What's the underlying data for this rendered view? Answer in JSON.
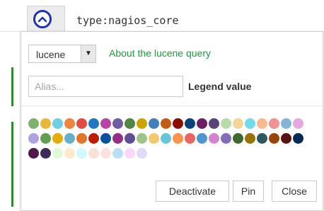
{
  "query": {
    "text": "type:nagios_core",
    "toggle_icon": "chevron-up-icon",
    "accent_color": "#1f33b0"
  },
  "popover": {
    "language_select": {
      "value": "lucene",
      "options": [
        "lucene"
      ]
    },
    "about_link": "About the lucene query",
    "alias_input": {
      "value": "",
      "placeholder": "Alias..."
    },
    "legend_label": "Legend value",
    "swatch_rows": [
      [
        "#7eb26d",
        "#eab839",
        "#6ed0e0",
        "#ef843c",
        "#e24d42",
        "#1f78c1",
        "#ba43a9",
        "#705da0",
        "#508642",
        "#cca300",
        "#447ebc",
        "#c15c17",
        "#890f02",
        "#0a437c",
        "#6d1f62",
        "#584477",
        "#b7dbab",
        "#f4d598",
        "#70dbed",
        "#f9ba8f",
        "#f29191",
        "#82b5d8",
        "#e5a8e2"
      ],
      [
        "#aea2e0",
        "#629e51",
        "#e5ac0e",
        "#64b0c8",
        "#e0752d",
        "#bf1b00",
        "#0a50a1",
        "#962d82",
        "#614d93",
        "#9ac48a",
        "#f2c96d",
        "#65c5db",
        "#f9934e",
        "#ea6460",
        "#5195ce",
        "#d683ce",
        "#806eb7",
        "#3f6833",
        "#967302",
        "#2f575e",
        "#99440a",
        "#58140c",
        "#052b51"
      ],
      [
        "#511749",
        "#3f2b5b",
        "#e0f9d7",
        "#fceaca",
        "#cffaff",
        "#f9e2d2",
        "#fce2de",
        "#badff4",
        "#f9d9f9",
        "#dedaf7"
      ]
    ],
    "buttons": {
      "deactivate": "Deactivate",
      "pin": "Pin",
      "close": "Close"
    },
    "link_color": "#1f9a3a"
  }
}
